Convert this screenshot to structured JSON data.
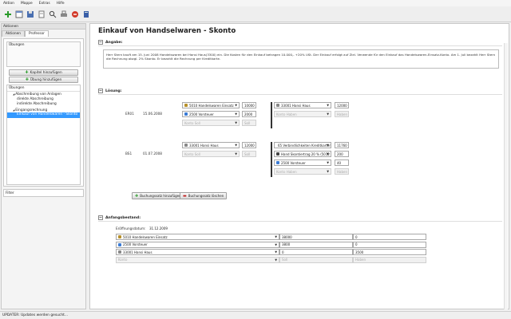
{
  "menu": [
    "Aktion",
    "Mappe",
    "Extras",
    "Hilfe"
  ],
  "toolbar_icons": [
    "plus-icon",
    "window-icon",
    "save-icon",
    "document-icon",
    "search-icon",
    "print-icon",
    "stop-icon",
    "book-icon"
  ],
  "left": {
    "header": "Aktionen",
    "tabs": [
      "Aktionen",
      "Professor"
    ],
    "group_title": "Übungen",
    "btn_kapitel": "Kapitel hinzufügen",
    "btn_uebung": "Übung hinzufügen",
    "tree_title": "Übungen",
    "tree": [
      {
        "label": "Abschreibung von Anlagen",
        "indent": 1,
        "prefix": "◢"
      },
      {
        "label": "direkte Abschreibung",
        "indent": 2,
        "prefix": ""
      },
      {
        "label": "indirekte Abschreibung",
        "indent": 2,
        "prefix": ""
      },
      {
        "label": "Eingangsrechnung",
        "indent": 1,
        "prefix": "◢"
      },
      {
        "label": "Einkauf von Handelswaren - Skonto",
        "indent": 2,
        "prefix": "",
        "selected": true
      }
    ],
    "filter_label": "Filter"
  },
  "main": {
    "title": "Einkauf von Handselwaren - Skonto",
    "angabe_label": "Angabe:",
    "angabe_text": "Herr Stern kauft am 15. Juni 2008 Handelswaren bei Hansi Haus(3300) ein. Die Kosten für den Einkauf betragen 10.000,- +20% USt. Der Einkauf erfolgt auf Ziel. Verwende für den Einkauf das Handelswaren-Einsatz-Konto. Am 1. Juli bezahlt Herr Stern die Rechnung abzgl. 2% Skonto. Er bezahlt die Rechnung per Kreditkarte.",
    "loesung_label": "Lösung:",
    "entries": [
      {
        "beleg": "ER01",
        "datum": "15.06.2008",
        "soll": [
          {
            "konto": "5010 Handelswaren Einsatz",
            "betrag": "10000"
          },
          {
            "konto": "2500 Vorsteuer",
            "betrag": "2000"
          },
          {
            "konto": "Konto Soll",
            "betrag": "Soll"
          }
        ],
        "haben": [
          {
            "konto": "33001 Hansi Haus",
            "betrag": "12000"
          },
          {
            "konto": "Konto Haben",
            "betrag": "Haben"
          }
        ]
      },
      {
        "beleg": "BS1",
        "datum": "01.07.2008",
        "soll": [
          {
            "konto": "33001 Hansi Haus",
            "betrag": "12000"
          },
          {
            "konto": "Konto Soll",
            "betrag": "Soll"
          }
        ],
        "haben": [
          {
            "konto": "65 Verbindlichkeiten Kreditkarten",
            "betrag": "11760"
          },
          {
            "konto": "Hand Skontiertrag 20 % (5012",
            "betrag": "200"
          },
          {
            "konto": "2500 Vorsteuer",
            "betrag": "40"
          },
          {
            "konto": "Konto Haben",
            "betrag": "Haben"
          }
        ]
      }
    ],
    "btn_add": "Buchungssatz hinzufügen",
    "btn_remove": "Buchungssatz löschen",
    "anfang_label": "Anfangsbestand:",
    "eroeffnung_label": "Eröffnungsdatum:",
    "eroeffnung_date": "31.12.2009",
    "anfang_rows": [
      {
        "konto": "5010 Handelswaren Einsatz",
        "soll": "38000",
        "haben": "0"
      },
      {
        "konto": "2500 Vorsteuer",
        "soll": "3800",
        "haben": "0"
      },
      {
        "konto": "33001 Hansi Haus",
        "soll": "0",
        "haben": "3500"
      },
      {
        "konto": "Konto",
        "soll": "Soll",
        "haben": "Haben",
        "disabled": true
      }
    ]
  },
  "status": "UPDATER: Updates werden gesucht..."
}
